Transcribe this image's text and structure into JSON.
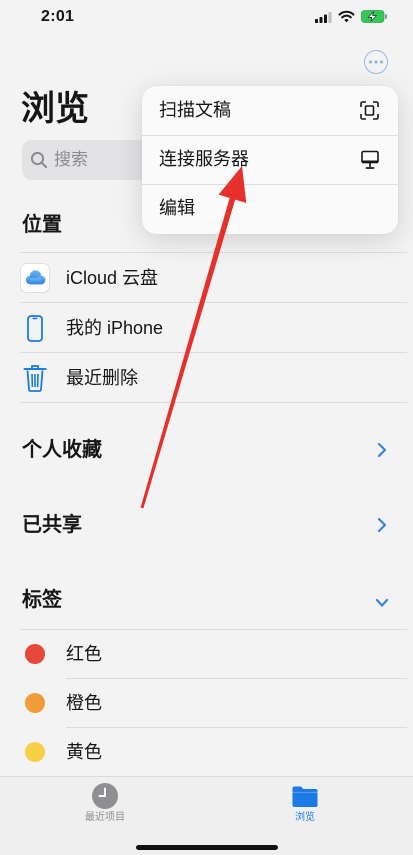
{
  "status_bar": {
    "time": "2:01"
  },
  "header": {
    "title": "浏览"
  },
  "search": {
    "placeholder": "搜索",
    "icon": "search-icon"
  },
  "locations": {
    "heading": "位置",
    "items": [
      {
        "label": "iCloud 云盘",
        "icon": "icloud-icon"
      },
      {
        "label": "我的 iPhone",
        "icon": "iphone-icon"
      },
      {
        "label": "最近删除",
        "icon": "trash-icon"
      }
    ]
  },
  "favorites": {
    "heading": "个人收藏",
    "icon": "chevron-right-icon"
  },
  "shared": {
    "heading": "已共享",
    "icon": "chevron-right-icon"
  },
  "tags": {
    "heading": "标签",
    "icon": "chevron-down-icon",
    "items": [
      {
        "label": "红色",
        "color": "#e8483b"
      },
      {
        "label": "橙色",
        "color": "#f19c38"
      },
      {
        "label": "黄色",
        "color": "#f8ce47"
      }
    ]
  },
  "menu": {
    "items": [
      {
        "label": "扫描文稿",
        "icon": "scan-icon"
      },
      {
        "label": "连接服务器",
        "icon": "monitor-icon"
      },
      {
        "label": "编辑"
      }
    ]
  },
  "tab_bar": {
    "tabs": [
      {
        "label": "最近项目",
        "icon": "clock-icon",
        "active": false
      },
      {
        "label": "浏览",
        "icon": "folder-icon",
        "active": true
      }
    ]
  },
  "colors": {
    "accent": "#1c7ae5",
    "annotation": "#e5302c",
    "battery": "#34c759"
  }
}
